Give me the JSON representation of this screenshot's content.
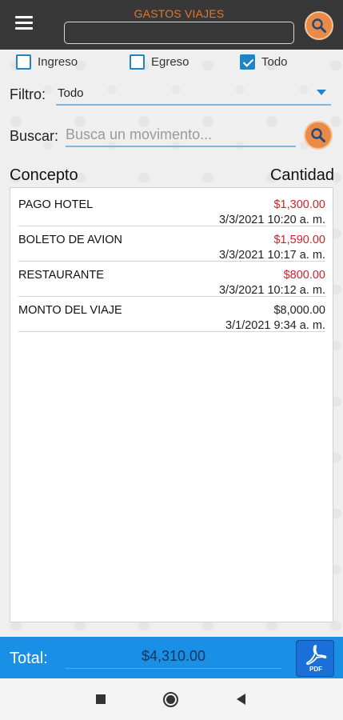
{
  "header": {
    "title": "GASTOS VIAJES",
    "input_value": ""
  },
  "filters": {
    "ingreso": {
      "label": "Ingreso",
      "checked": false
    },
    "egreso": {
      "label": "Egreso",
      "checked": false
    },
    "todo": {
      "label": "Todo",
      "checked": true
    }
  },
  "filtro": {
    "label": "Filtro:",
    "selected": "Todo"
  },
  "buscar": {
    "label": "Buscar:",
    "placeholder": "Busca un movimento..."
  },
  "table": {
    "col_concepto": "Concepto",
    "col_cantidad": "Cantidad",
    "rows": [
      {
        "concept": "PAGO HOTEL",
        "amount": "$1,300.00",
        "date": "3/3/2021 10:20 a. m.",
        "type": "egreso"
      },
      {
        "concept": "BOLETO DE AVION",
        "amount": "$1,590.00",
        "date": "3/3/2021 10:17 a. m.",
        "type": "egreso"
      },
      {
        "concept": "RESTAURANTE",
        "amount": "$800.00",
        "date": "3/3/2021 10:12 a. m.",
        "type": "egreso"
      },
      {
        "concept": "MONTO DEL VIAJE",
        "amount": "$8,000.00",
        "date": "3/1/2021 9:34 a. m.",
        "type": "ingreso"
      }
    ]
  },
  "total": {
    "label": "Total:",
    "value": "$4,310.00"
  },
  "pdf_button": {
    "label": "PDF"
  },
  "colors": {
    "header_bg": "#383838",
    "title_orange": "#e8742b",
    "accent_blue": "#1f84c6",
    "total_bar_blue": "#1a8fe6",
    "expense_red": "#d0232a",
    "search_orange": "#e98b47"
  },
  "icons": {
    "menu": "hamburger-menu-icon",
    "search": "search-icon",
    "pdf": "pdf-icon",
    "dropdown": "chevron-down-icon"
  }
}
